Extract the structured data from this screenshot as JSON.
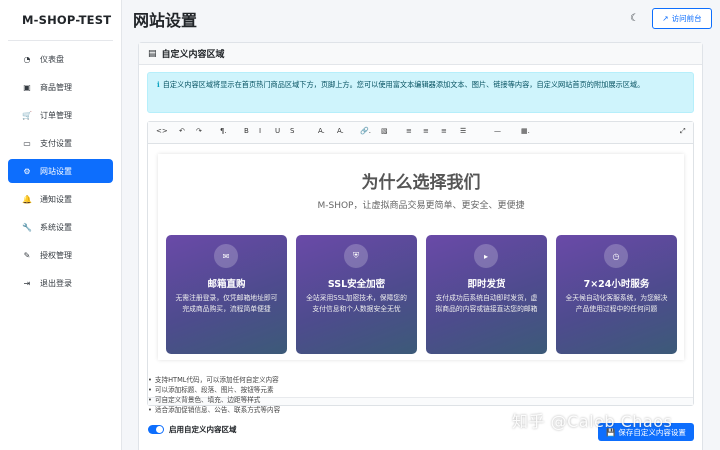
{
  "brand": "M-SHOP-TEST",
  "sidebar": {
    "items": [
      {
        "label": "仪表盘",
        "icon": "dashboard-icon",
        "glyph": "◔"
      },
      {
        "label": "商品管理",
        "icon": "box-icon",
        "glyph": "▣"
      },
      {
        "label": "订单管理",
        "icon": "cart-icon",
        "glyph": "🛒"
      },
      {
        "label": "支付设置",
        "icon": "card-icon",
        "glyph": "▭"
      },
      {
        "label": "网站设置",
        "icon": "gear-icon",
        "glyph": "⚙",
        "active": true
      },
      {
        "label": "通知设置",
        "icon": "bell-icon",
        "glyph": "🔔"
      },
      {
        "label": "系统设置",
        "icon": "wrench-icon",
        "glyph": "🔧"
      },
      {
        "label": "授权管理",
        "icon": "key-icon",
        "glyph": "✎"
      },
      {
        "label": "退出登录",
        "icon": "logout-icon",
        "glyph": "⇥"
      }
    ]
  },
  "header": {
    "title": "网站设置",
    "theme_toggle_glyph": "☾",
    "visit_label": "访问前台",
    "visit_glyph": "↗"
  },
  "card": {
    "title": "自定义内容区域",
    "title_glyph": "▤",
    "info_glyph": "ℹ",
    "info_text": "自定义内容区域将显示在首页热门商品区域下方，页脚上方。您可以使用富文本编辑器添加文本、图片、链接等内容，自定义网站首页的附加展示区域。"
  },
  "toolbar": [
    {
      "name": "code-view-icon",
      "glyph": "<>"
    },
    {
      "name": "undo-icon",
      "glyph": "↶"
    },
    {
      "name": "redo-icon",
      "glyph": "↷"
    },
    {
      "name": "paragraph-icon",
      "glyph": "¶."
    },
    {
      "name": "bold-icon",
      "glyph": "B"
    },
    {
      "name": "italic-icon",
      "glyph": "I"
    },
    {
      "name": "underline-icon",
      "glyph": "U"
    },
    {
      "name": "strike-icon",
      "glyph": "S"
    },
    {
      "name": "font-color-icon",
      "glyph": "A."
    },
    {
      "name": "bg-color-icon",
      "glyph": "A."
    },
    {
      "name": "link-icon",
      "glyph": "🔗."
    },
    {
      "name": "image-icon",
      "glyph": "▧"
    },
    {
      "name": "align-left-icon",
      "glyph": "≡"
    },
    {
      "name": "align-center-icon",
      "glyph": "≡"
    },
    {
      "name": "align-right-icon",
      "glyph": "≡"
    },
    {
      "name": "list-icon",
      "glyph": "☰"
    },
    {
      "name": "hr-icon",
      "glyph": "—"
    },
    {
      "name": "table-icon",
      "glyph": "▦."
    },
    {
      "name": "fullscreen-icon",
      "glyph": "⤢"
    }
  ],
  "content": {
    "title": "为什么选择我们",
    "subtitle": "M-SHOP，让虚拟商品交易更简单、更安全、更便捷",
    "features": [
      {
        "glyph": "✉",
        "icon": "mail-icon",
        "title": "邮箱直购",
        "desc": "无需注册登录，仅凭邮箱地址即可完成商品购买，流程简单便捷"
      },
      {
        "glyph": "⛨",
        "icon": "shield-icon",
        "title": "SSL安全加密",
        "desc": "全站采用SSL加密技术，保障您的支付信息和个人数据安全无忧"
      },
      {
        "glyph": "▸",
        "icon": "send-icon",
        "title": "即时发货",
        "desc": "支付成功后系统自动即时发货，虚拟商品的内容或链接直达您的邮箱"
      },
      {
        "glyph": "◷",
        "icon": "clock-icon",
        "title": "7×24小时服务",
        "desc": "全天候自动化客服系统，为您解决产品使用过程中的任何问题"
      }
    ]
  },
  "tips": [
    "支持HTML代码，可以添加任何自定义内容",
    "可以添加标题、段落、图片、按钮等元素",
    "可自定义背景色、填充、边距等样式",
    "适合添加促销信息、公告、联系方式等内容"
  ],
  "toggle": {
    "label": "启用自定义内容区域",
    "checked": true
  },
  "save": {
    "label": "保存自定义内容设置",
    "glyph": "💾"
  },
  "watermark": "知乎 @Caleb Chaos"
}
